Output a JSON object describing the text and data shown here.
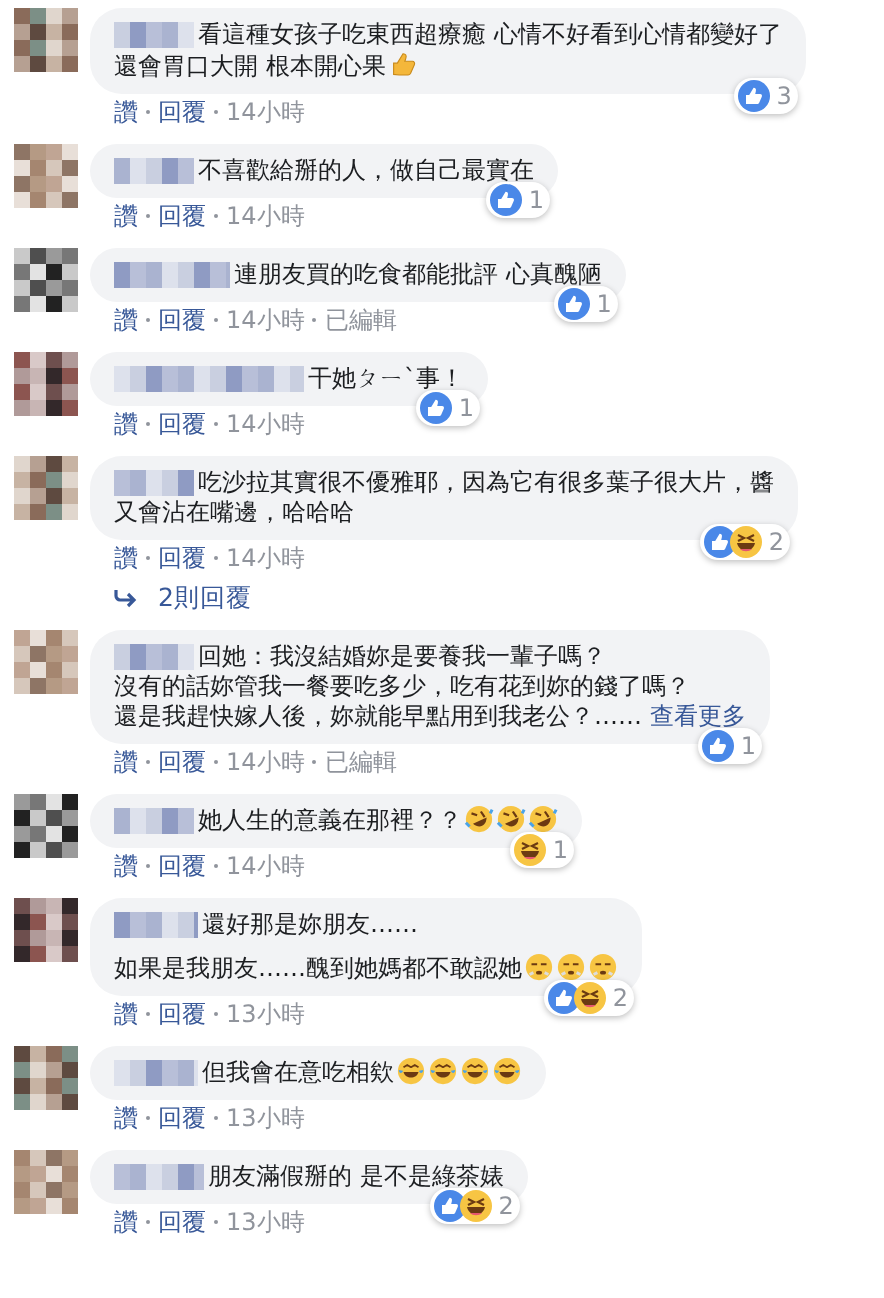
{
  "comments": [
    {
      "paragraphs": [
        [
          "看這種女孩子吃東西超療癒 心情不好看到心情都變好了",
          "還會胃口大開 根本開心果"
        ]
      ],
      "emojis": [
        {
          "kind": "thumbs_up"
        }
      ],
      "reactions": [
        {
          "kind": "like"
        }
      ],
      "reaction_count": "3",
      "like": "讚",
      "reply": "回覆",
      "time": "14小時"
    },
    {
      "paragraphs": [
        [
          "不喜歡給掰的人，做自己最實在"
        ]
      ],
      "reactions": [
        {
          "kind": "like"
        }
      ],
      "reaction_count": "1",
      "like": "讚",
      "reply": "回覆",
      "time": "14小時"
    },
    {
      "paragraphs": [
        [
          "連朋友買的吃食都能批評 心真醜陋"
        ]
      ],
      "reactions": [
        {
          "kind": "like"
        }
      ],
      "reaction_count": "1",
      "like": "讚",
      "reply": "回覆",
      "time": "14小時",
      "edited": "已編輯"
    },
    {
      "paragraphs": [
        [
          "干她ㄆㄧˋ事！"
        ]
      ],
      "reactions": [
        {
          "kind": "like"
        }
      ],
      "reaction_count": "1",
      "like": "讚",
      "reply": "回覆",
      "time": "14小時"
    },
    {
      "paragraphs": [
        [
          "吃沙拉其實很不優雅耶，因為它有很多葉子很大片，醬",
          "又會沾在嘴邊，哈哈哈"
        ]
      ],
      "reactions": [
        {
          "kind": "like"
        },
        {
          "kind": "haha"
        }
      ],
      "reaction_count": "2",
      "like": "讚",
      "reply": "回覆",
      "time": "14小時",
      "replies": "2則回覆"
    },
    {
      "paragraphs": [
        [
          "回她：我沒結婚妳是要養我一輩子嗎？",
          "沒有的話妳管我一餐要吃多少，吃有花到妳的錢了嗎？",
          "還是我趕快嫁人後，妳就能早點用到我老公？……"
        ]
      ],
      "see_more": "查看更多",
      "reactions": [
        {
          "kind": "like"
        }
      ],
      "reaction_count": "1",
      "like": "讚",
      "reply": "回覆",
      "time": "14小時",
      "edited": "已編輯"
    },
    {
      "paragraphs": [
        [
          "她人生的意義在那裡？？"
        ]
      ],
      "emojis": [
        {
          "kind": "rofl"
        },
        {
          "kind": "rofl"
        },
        {
          "kind": "rofl"
        }
      ],
      "reactions": [
        {
          "kind": "haha"
        }
      ],
      "reaction_count": "1",
      "like": "讚",
      "reply": "回覆",
      "time": "14小時"
    },
    {
      "paragraphs": [
        [
          "還好那是妳朋友……"
        ],
        [
          "如果是我朋友……醜到她媽都不敢認她"
        ]
      ],
      "emojis": [
        {
          "kind": "steam"
        },
        {
          "kind": "steam"
        },
        {
          "kind": "steam"
        }
      ],
      "reactions": [
        {
          "kind": "like"
        },
        {
          "kind": "haha"
        }
      ],
      "reaction_count": "2",
      "like": "讚",
      "reply": "回覆",
      "time": "13小時"
    },
    {
      "paragraphs": [
        [
          "但我會在意吃相欸"
        ]
      ],
      "emojis": [
        {
          "kind": "joy"
        },
        {
          "kind": "joy"
        },
        {
          "kind": "joy"
        },
        {
          "kind": "joy"
        }
      ],
      "like": "讚",
      "reply": "回覆",
      "time": "13小時"
    },
    {
      "paragraphs": [
        [
          "朋友滿假掰的 是不是綠茶婊"
        ]
      ],
      "reactions": [
        {
          "kind": "like"
        },
        {
          "kind": "haha"
        }
      ],
      "reaction_count": "2",
      "like": "讚",
      "reply": "回覆",
      "time": "13小時"
    }
  ]
}
